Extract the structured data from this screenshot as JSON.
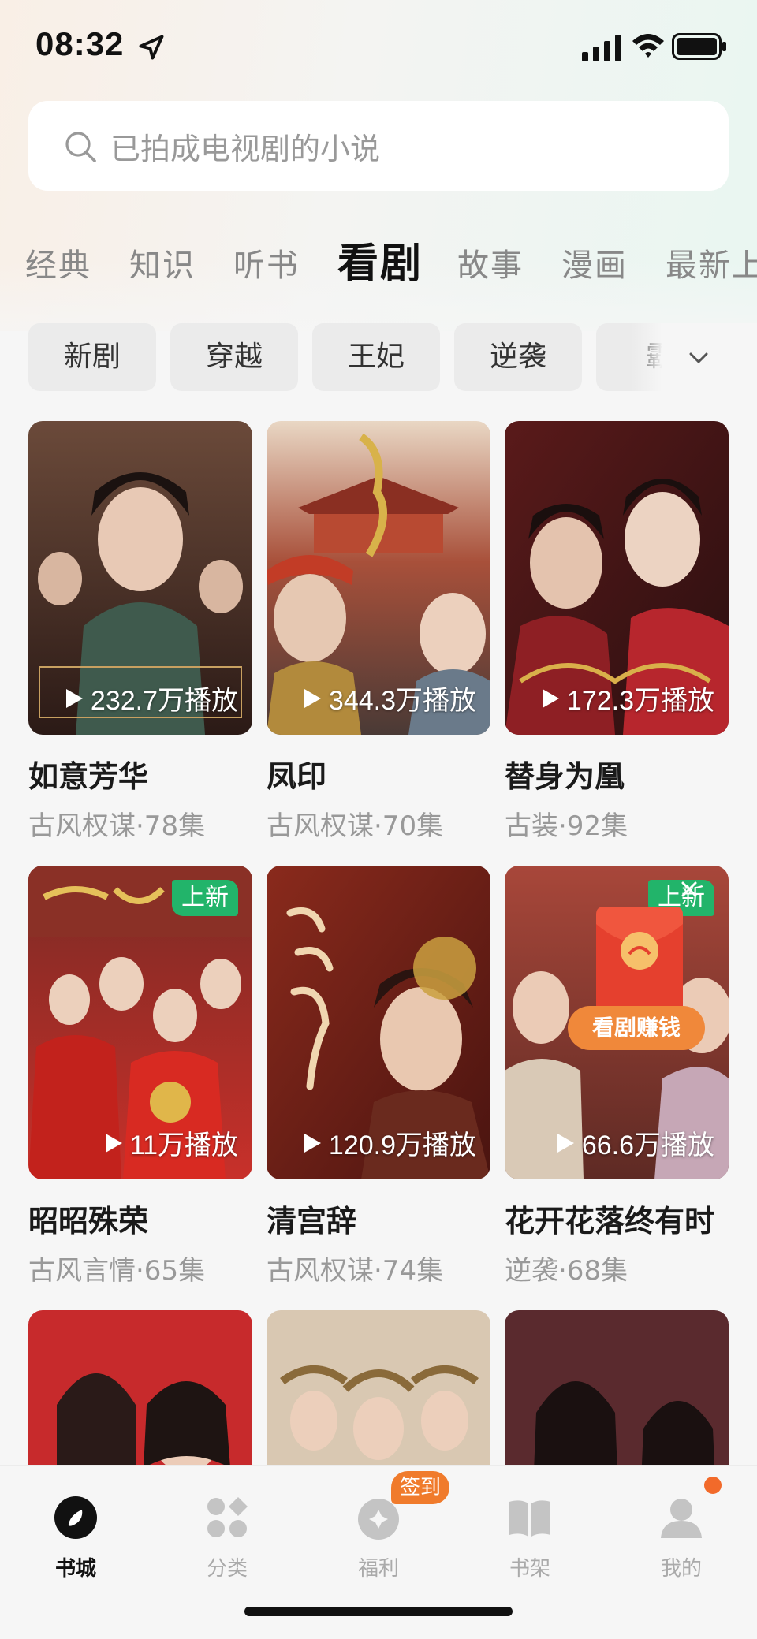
{
  "status": {
    "time": "08:32"
  },
  "search": {
    "placeholder": "已拍成电视剧的小说"
  },
  "tabs": [
    {
      "label": "经典",
      "active": false
    },
    {
      "label": "知识",
      "active": false
    },
    {
      "label": "听书",
      "active": false
    },
    {
      "label": "看剧",
      "active": true
    },
    {
      "label": "故事",
      "active": false
    },
    {
      "label": "漫画",
      "active": false
    },
    {
      "label": "最新上",
      "active": false
    }
  ],
  "chips": [
    "新剧",
    "穿越",
    "王妃",
    "逆袭",
    "霸"
  ],
  "dramas": [
    {
      "title": "如意芳华",
      "meta": "古风权谋·78集",
      "plays": "232.7万播放",
      "badge": ""
    },
    {
      "title": "凤印",
      "meta": "古风权谋·70集",
      "plays": "344.3万播放",
      "badge": ""
    },
    {
      "title": "替身为凰",
      "meta": "古装·92集",
      "plays": "172.3万播放",
      "badge": ""
    },
    {
      "title": "昭昭殊荣",
      "meta": "古风言情·65集",
      "plays": "11万播放",
      "badge": "上新"
    },
    {
      "title": "清宫辞",
      "meta": "古风权谋·74集",
      "plays": "120.9万播放",
      "badge": ""
    },
    {
      "title": "花开花落终有时",
      "meta": "逆袭·68集",
      "plays": "66.6万播放",
      "badge": "上新"
    }
  ],
  "promo": {
    "label": "看剧赚钱"
  },
  "nav": {
    "items": [
      {
        "label": "书城",
        "icon": "compass-icon",
        "active": true
      },
      {
        "label": "分类",
        "icon": "grid-icon",
        "active": false
      },
      {
        "label": "福利",
        "icon": "gift-icon",
        "active": false
      },
      {
        "label": "书架",
        "icon": "book-icon",
        "active": false
      },
      {
        "label": "我的",
        "icon": "user-icon",
        "active": false
      }
    ],
    "checkin_badge": "签到"
  },
  "colors": {
    "accent_green": "#22b46a",
    "accent_orange": "#f07b2c",
    "text_primary": "#1a1a1a",
    "text_secondary": "#999999"
  }
}
